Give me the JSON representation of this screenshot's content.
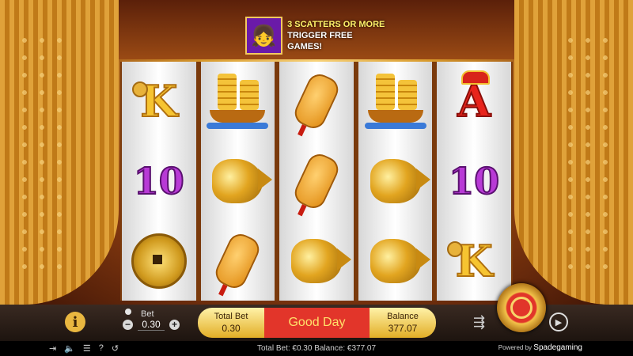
{
  "banner": {
    "line1": "3 SCATTERS OR MORE",
    "line2": "TRIGGER FREE GAMES!"
  },
  "reels": [
    [
      "K",
      "10",
      "coin"
    ],
    [
      "junk",
      "fish",
      "lantern"
    ],
    [
      "lantern",
      "lantern",
      "fish"
    ],
    [
      "junk",
      "fish",
      "fish"
    ],
    [
      "A",
      "10",
      "K"
    ]
  ],
  "controls": {
    "info_label": "i",
    "bet_label": "Bet",
    "bet_value": "0.30",
    "minus": "−",
    "plus": "+",
    "total_bet_label": "Total Bet",
    "total_bet_value": "0.30",
    "message": "Good Day",
    "balance_label": "Balance",
    "balance_value": "377.07"
  },
  "footer": {
    "summary": "Total Bet: €0.30  Balance: €377.07",
    "powered_by": "Powered by",
    "brand": "Spadegaming"
  }
}
